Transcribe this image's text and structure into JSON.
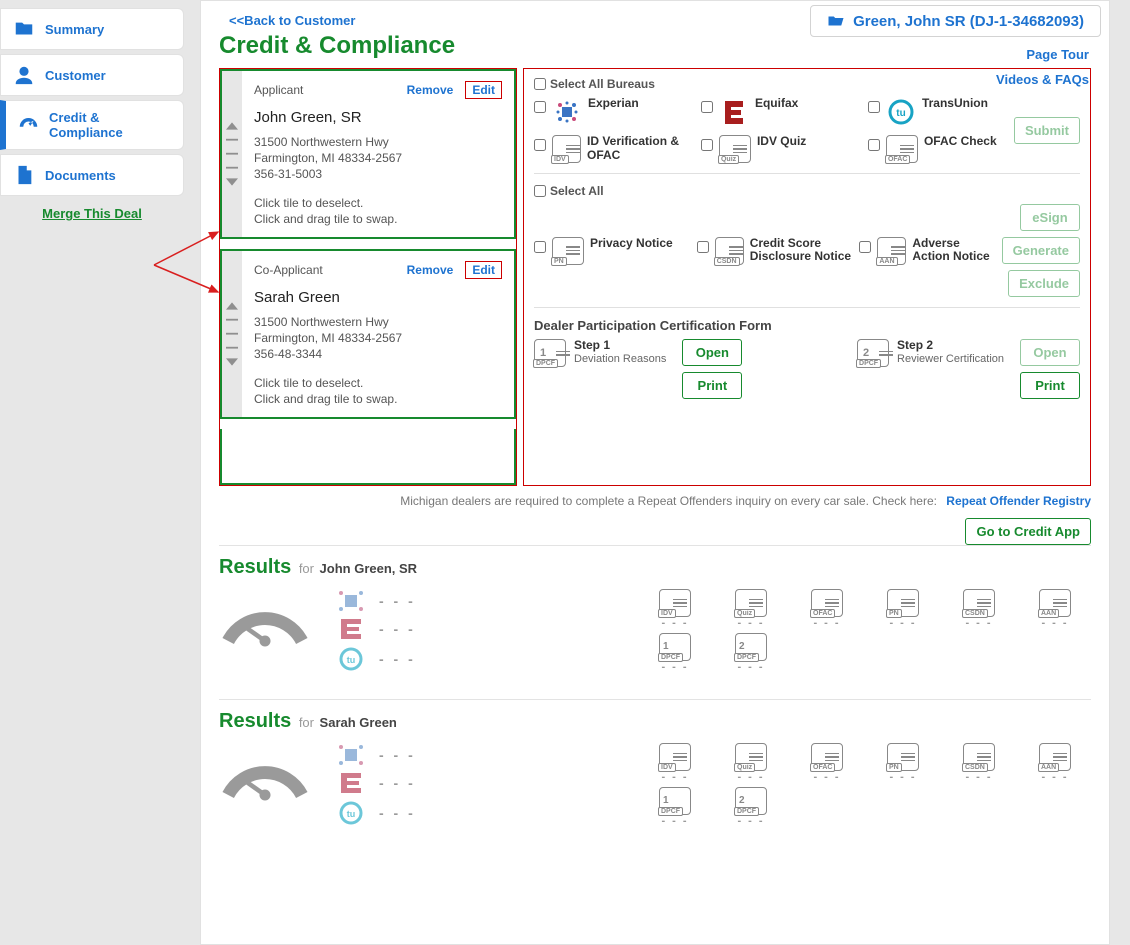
{
  "sidebar": {
    "items": [
      {
        "label": "Summary"
      },
      {
        "label": "Customer"
      },
      {
        "label": "Credit & Compliance"
      },
      {
        "label": "Documents"
      }
    ],
    "merge_label": "Merge This Deal"
  },
  "header": {
    "customer_display": "Green, John SR (DJ-1-34682093)",
    "back_label": "<<Back to Customer",
    "page_title": "Credit & Compliance",
    "page_tour_label": "Page Tour",
    "videos_label": "Videos & FAQs"
  },
  "applicants": [
    {
      "role": "Applicant",
      "remove_label": "Remove",
      "edit_label": "Edit",
      "name": "John Green, SR",
      "addr1": "31500 Northwestern Hwy",
      "addr2": "Farmington, MI 48334-2567",
      "phone": "356-31-5003",
      "hint1": "Click tile to deselect.",
      "hint2": "Click and drag tile to swap."
    },
    {
      "role": "Co-Applicant",
      "remove_label": "Remove",
      "edit_label": "Edit",
      "name": "Sarah Green",
      "addr1": "31500 Northwestern Hwy",
      "addr2": "Farmington, MI 48334-2567",
      "phone": "356-48-3344",
      "hint1": "Click tile to deselect.",
      "hint2": "Click and drag tile to swap."
    }
  ],
  "bureaus_panel": {
    "select_all": "Select All Bureaus",
    "options": [
      "Experian",
      "Equifax",
      "TransUnion",
      "ID Verification & OFAC",
      "IDV Quiz",
      "OFAC Check"
    ],
    "submit_label": "Submit"
  },
  "notices_panel": {
    "select_all": "Select All",
    "options": [
      "Privacy Notice",
      "Credit Score Disclosure Notice",
      "Adverse Action Notice"
    ],
    "tags": [
      "PN",
      "CSDN",
      "AAN"
    ],
    "esign_label": "eSign",
    "generate_label": "Generate",
    "exclude_label": "Exclude"
  },
  "dpcf": {
    "heading": "Dealer Participation Certification Form",
    "step1_title": "Step 1",
    "step1_sub": "Deviation Reasons",
    "step2_title": "Step 2",
    "step2_sub": "Reviewer Certification",
    "open_label": "Open",
    "print_label": "Print"
  },
  "footer": {
    "note": "Michigan dealers are required to complete a Repeat Offenders inquiry on every car sale. Check here:",
    "link": "Repeat Offender Registry",
    "go_label": "Go to Credit App",
    "dash": "- - -"
  },
  "results": [
    {
      "label": "Results",
      "for": "for",
      "name": "John Green, SR"
    },
    {
      "label": "Results",
      "for": "for",
      "name": "Sarah Green"
    }
  ],
  "mini_tags": [
    "IDV",
    "Quiz",
    "OFAC",
    "PN",
    "CSDN",
    "AAN",
    "DPCF",
    "DPCF"
  ]
}
